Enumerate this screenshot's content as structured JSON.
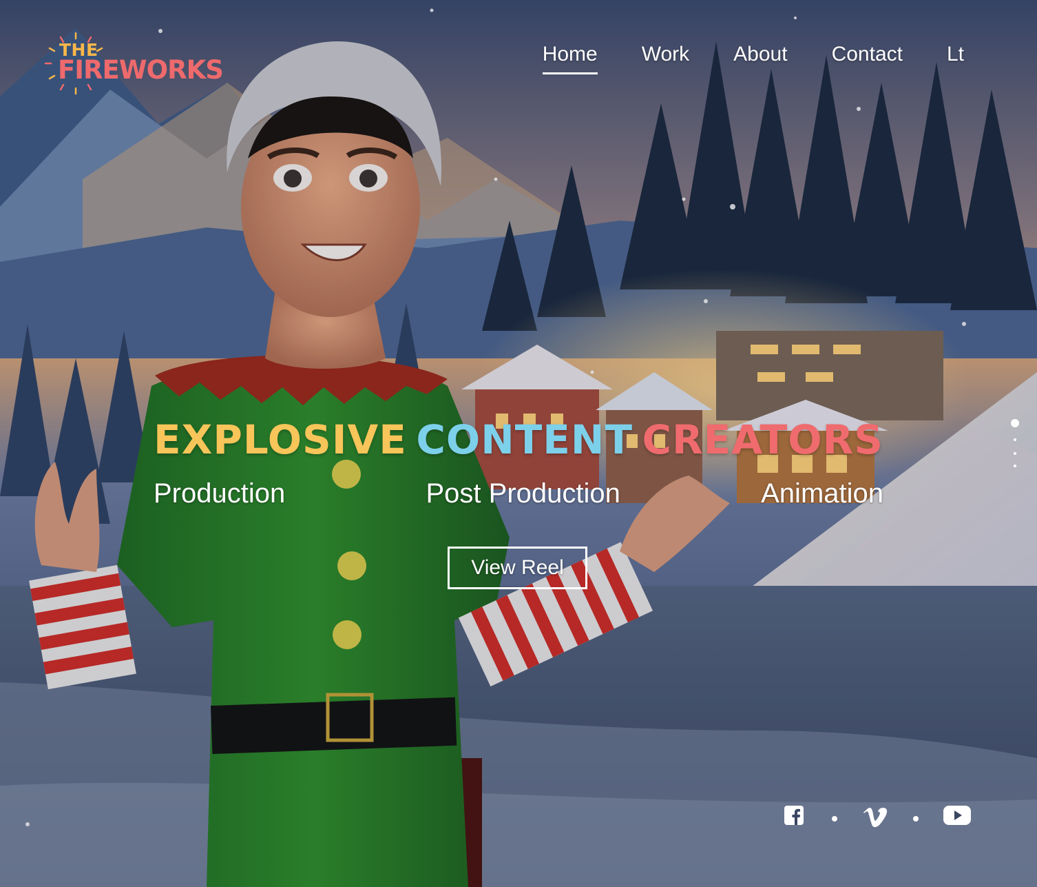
{
  "brand": {
    "logo_the": "THE",
    "logo_fireworks": "FIREWORKS"
  },
  "nav": {
    "items": [
      {
        "label": "Home",
        "active": true
      },
      {
        "label": "Work"
      },
      {
        "label": "About"
      },
      {
        "label": "Contact"
      },
      {
        "label": "Lt"
      }
    ]
  },
  "hero": {
    "headline": [
      {
        "text": "EXPLOSIVE",
        "color": "#f7c55a"
      },
      {
        "text": "CONTENT",
        "color": "#7dd0ea"
      },
      {
        "text": "CREATORS",
        "color": "#ef6b6e"
      }
    ],
    "services": [
      "Production",
      "Post Production",
      "Animation"
    ],
    "cta_label": "View Reel"
  },
  "slider": {
    "total": 4,
    "active_index": 0
  },
  "social": {
    "icons": [
      "facebook-icon",
      "vimeo-icon",
      "youtube-icon"
    ]
  },
  "colors": {
    "accent_yellow": "#f7c55a",
    "accent_blue": "#7dd0ea",
    "accent_red": "#ef6b6e"
  }
}
